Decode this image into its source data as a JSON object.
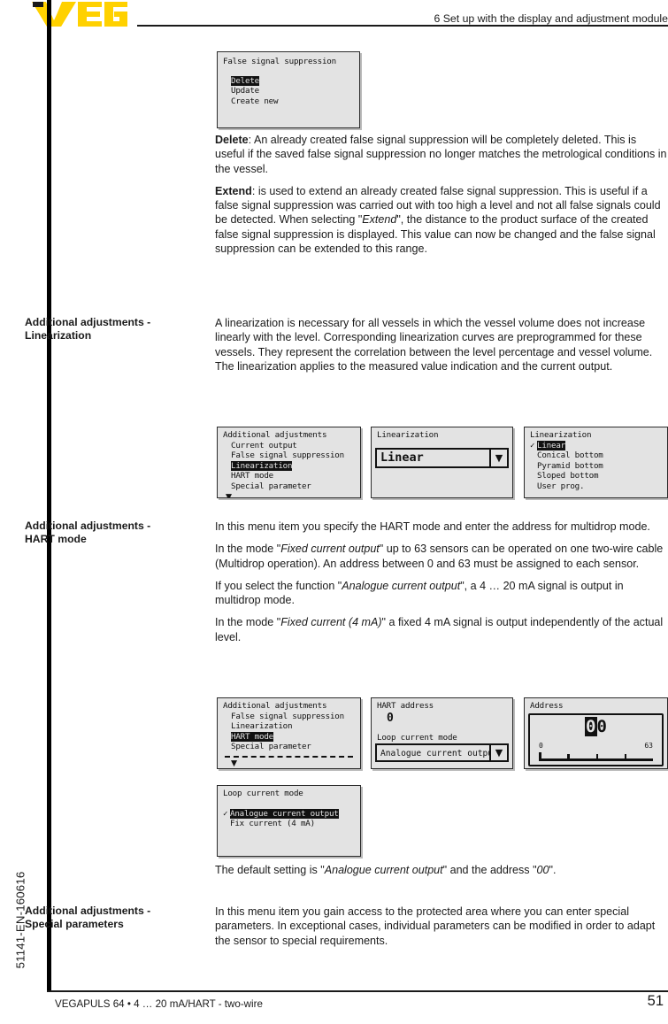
{
  "header": {
    "logo_text": "VEGA",
    "logo_color": "#FFD100",
    "chapter_title": "6 Set up with the display and adjustment module"
  },
  "sidebar": {
    "doc_code": "51141-EN-160616"
  },
  "margin_headings": {
    "linearization": "Additional adjustments - Linearization",
    "linearization_line1": "Additional adjustments -",
    "linearization_line2": "Linearization",
    "hart_line1": "Additional adjustments -",
    "hart_line2": "HART mode",
    "special_line1": "Additional adjustments -",
    "special_line2": "Special parameters"
  },
  "lcd_fss": {
    "title": "False signal suppression",
    "items": [
      {
        "label": "Delete",
        "selected": true
      },
      {
        "label": "Update",
        "selected": false
      },
      {
        "label": "Create new",
        "selected": false
      }
    ]
  },
  "paragraphs": {
    "delete_lead": "Delete",
    "delete_text": ": An already created false signal suppression will be completely deleted. This is useful if the saved false signal suppression no longer matches the metrological conditions in the vessel.",
    "extend_lead": "Extend",
    "extend_text_1": ": is used to extend an already created false signal suppression. This is useful if a false signal suppression was carried out with too high a level and not all false signals could be detected. When selecting \"",
    "extend_italic": "Extend",
    "extend_text_2": "\", the distance to the product surface of the created false signal suppression is displayed. This value can now be changed and the false signal suppression can be extended to this range.",
    "linearization_text": "A linearization is necessary for all vessels in which the vessel volume does not increase linearly with the level. Corresponding linearization curves are preprogrammed for these vessels. They represent the correlation between the level percentage and vessel volume. The linearization applies to the measured value indication and the current output.",
    "hart_p1": "In this menu item you specify the HART mode and enter the address for multidrop mode.",
    "hart_p2_a": "In the mode \"",
    "hart_p2_i": "Fixed current output",
    "hart_p2_b": "\" up to 63 sensors can be operated on one two-wire cable (Multidrop operation). An address between 0 and 63 must be assigned to each sensor.",
    "hart_p3_a": "If you select the function \"",
    "hart_p3_i": "Analogue current output",
    "hart_p3_b": "\", a 4 … 20 mA signal is output in multidrop mode.",
    "hart_p4_a": "In the mode \"",
    "hart_p4_i": "Fixed current (4 mA)",
    "hart_p4_b": "\" a fixed 4 mA signal is output independently of the actual level.",
    "default_a": "The default setting is \"",
    "default_i1": "Analogue current output",
    "default_b": "\" and the address \"",
    "default_i2": "00",
    "default_c": "\".",
    "special_text": "In this menu item you gain access to the protected area where you can enter special parameters. In exceptional cases, individual parameters can be modified in order to adapt the sensor to special requirements."
  },
  "lcd_addadj_lin": {
    "title": "Additional adjustments",
    "items": [
      {
        "label": "Current output",
        "selected": false
      },
      {
        "label": "False signal suppression",
        "selected": false
      },
      {
        "label": "Linearization",
        "selected": true
      },
      {
        "label": "HART mode",
        "selected": false
      },
      {
        "label": "Special parameter",
        "selected": false
      }
    ],
    "scroll_indicator": "▼"
  },
  "lcd_lin_value": {
    "title": "Linearization",
    "value": "Linear",
    "dropdown_icon": "▼"
  },
  "lcd_lin_list": {
    "title": "Linearization",
    "items": [
      {
        "label": "Linear",
        "selected": true,
        "checked": true
      },
      {
        "label": "Conical bottom",
        "selected": false,
        "checked": false
      },
      {
        "label": "Pyramid bottom",
        "selected": false,
        "checked": false
      },
      {
        "label": "Sloped bottom",
        "selected": false,
        "checked": false
      },
      {
        "label": "User prog.",
        "selected": false,
        "checked": false
      }
    ],
    "check_glyph": "✓"
  },
  "lcd_addadj_hart": {
    "title": "Additional adjustments",
    "items": [
      {
        "label": "False signal suppression",
        "selected": false
      },
      {
        "label": "Linearization",
        "selected": false
      },
      {
        "label": "HART mode",
        "selected": true
      },
      {
        "label": "Special parameter",
        "selected": false
      }
    ],
    "scroll_indicator": "▼"
  },
  "lcd_hart_address": {
    "title": "HART address",
    "address_value": "0",
    "sub_title": "Loop current mode",
    "mode_value": "Analogue current output",
    "dropdown_icon": "▼"
  },
  "lcd_address": {
    "title": "Address",
    "digit_selected": "0",
    "digit_rest": "0",
    "scale_min": "0",
    "scale_max": "63"
  },
  "lcd_loop_mode": {
    "title": "Loop current mode",
    "items": [
      {
        "label": "Analogue current output",
        "selected": true,
        "checked": true
      },
      {
        "label": "Fix current (4 mA)",
        "selected": false,
        "checked": false
      }
    ],
    "check_glyph": "✓"
  },
  "footer": {
    "left": "VEGAPULS 64 • 4 … 20 mA/HART - two-wire",
    "page_number": "51"
  }
}
